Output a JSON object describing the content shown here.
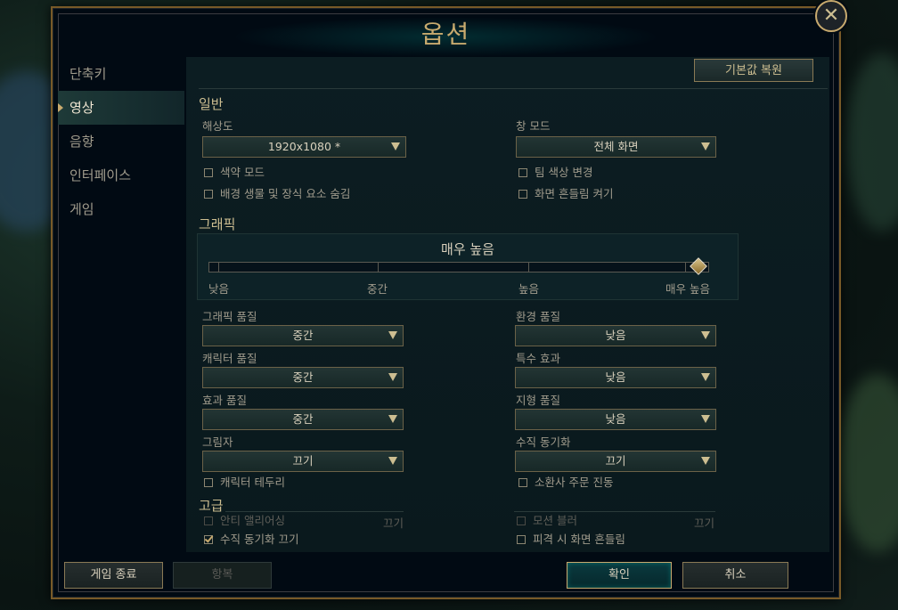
{
  "dialog": {
    "title": "옵션"
  },
  "sidebar": {
    "items": [
      {
        "label": "단축키"
      },
      {
        "label": "영상"
      },
      {
        "label": "음향"
      },
      {
        "label": "인터페이스"
      },
      {
        "label": "게임"
      }
    ]
  },
  "content": {
    "reset_label": "기본값 복원",
    "general": {
      "title": "일반",
      "resolution_label": "해상도",
      "resolution_value": "1920x1080 *",
      "window_mode_label": "창 모드",
      "window_mode_value": "전체 화면",
      "colorblind": "색약 모드",
      "team_color": "팀 색상 변경",
      "hide_eye_candy": "배경 생물 및 장식 요소 숨김",
      "screen_shake": "화면 흔들림 켜기"
    },
    "graphics": {
      "title": "그래픽",
      "current_preset": "매우 높음",
      "ticks": [
        "낮음",
        "중간",
        "높음",
        "매우 높음"
      ],
      "preset_level": 1.0,
      "char_quality_label": "그래픽 품질",
      "char_quality_value": "중간",
      "env_quality_label": "환경 품질",
      "env_quality_value": "낮음",
      "character_quality_label": "캐릭터 품질",
      "character_quality_value": "중간",
      "effects_label": "특수 효과",
      "effects_value": "낮음",
      "effect_quality_label": "효과 품질",
      "effect_quality_value": "중간",
      "terrain_label": "지형 품질",
      "terrain_value": "낮음",
      "shadow_label": "그림자",
      "shadow_value": "끄기",
      "vsync_label": "수직 동기화",
      "vsync_value": "끄기",
      "char_outline": "캐릭터 테두리",
      "summoner_vibrate": "소환사 주문 진동"
    },
    "advanced": {
      "title": "고급",
      "antialias": "안티 앨리어싱",
      "antialias_value": "끄기",
      "motion_blur": "모션 블러",
      "motion_blur_value": "끄기",
      "vsync_off": "수직 동기화 끄기",
      "hit_shake": "피격 시 화면 흔들림"
    }
  },
  "footer": {
    "exit_game": "게임 종료",
    "surrender": "항복",
    "confirm": "확인",
    "cancel": "취소"
  },
  "colors": {
    "gold": "#c8aa6e",
    "teal": "#0ac8b9",
    "bg": "#010a13"
  }
}
